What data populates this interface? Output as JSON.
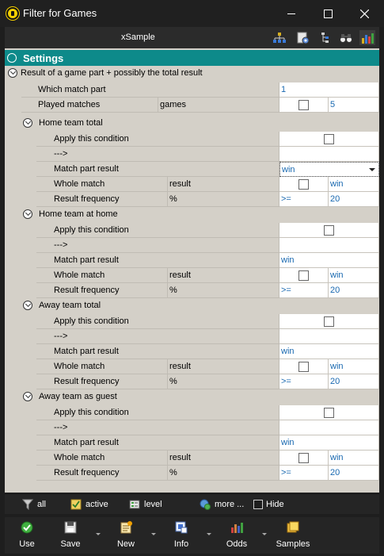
{
  "window": {
    "title": "Filter for Games"
  },
  "toolbar": {
    "sample_label": "xSample"
  },
  "category": {
    "title": "Settings"
  },
  "section": {
    "title": "Result of a game part + possibly the total result"
  },
  "top_rows": {
    "which_match_part": {
      "label": "Which match part",
      "value": "1"
    },
    "played_matches": {
      "label": "Played matches",
      "unit": "games",
      "checked": false,
      "value": "5"
    }
  },
  "groups": [
    {
      "title": "Home team total",
      "apply_label": "Apply this condition",
      "arrow_label": "--->",
      "match_part_label": "Match part result",
      "match_part_value": "win",
      "whole_match_label": "Whole match",
      "whole_match_unit": "result",
      "whole_match_value": "win",
      "freq_label": "Result frequency",
      "freq_unit": "%",
      "freq_op": ">=",
      "freq_value": "20"
    },
    {
      "title": "Home team at home",
      "apply_label": "Apply this condition",
      "arrow_label": "--->",
      "match_part_label": "Match part result",
      "match_part_value": "win",
      "whole_match_label": "Whole match",
      "whole_match_unit": "result",
      "whole_match_value": "win",
      "freq_label": "Result frequency",
      "freq_unit": "%",
      "freq_op": ">=",
      "freq_value": "20"
    },
    {
      "title": "Away team total",
      "apply_label": "Apply this condition",
      "arrow_label": "--->",
      "match_part_label": "Match part result",
      "match_part_value": "win",
      "whole_match_label": "Whole match",
      "whole_match_unit": "result",
      "whole_match_value": "win",
      "freq_label": "Result frequency",
      "freq_unit": "%",
      "freq_op": ">=",
      "freq_value": "20"
    },
    {
      "title": "Away team as guest",
      "apply_label": "Apply this condition",
      "arrow_label": "--->",
      "match_part_label": "Match part result",
      "match_part_value": "win",
      "whole_match_label": "Whole match",
      "whole_match_unit": "result",
      "whole_match_value": "win",
      "freq_label": "Result frequency",
      "freq_unit": "%",
      "freq_op": ">=",
      "freq_value": "20"
    }
  ],
  "filter_bar": {
    "all_label": "all",
    "active_label": "active",
    "level_label": "level",
    "more_label": "more ...",
    "hide_label": "Hide"
  },
  "actions": {
    "use_label": "Use",
    "save_label": "Save",
    "new_label": "New",
    "info_label": "Info",
    "odds_label": "Odds",
    "samples_label": "Samples"
  },
  "colors": {
    "category_header": "#0d8a8a",
    "panel_bg": "#d4d0c8",
    "value_text": "#1868b0"
  }
}
